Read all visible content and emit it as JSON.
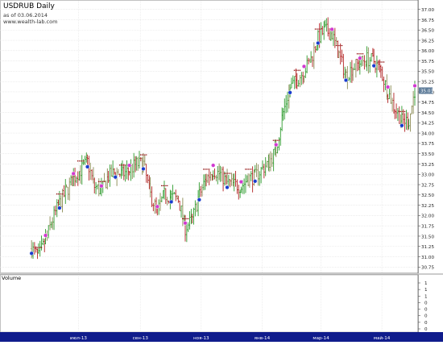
{
  "header": {
    "title": "USDRUB Daily",
    "as_of": "as of 03.06.2014",
    "source": "www.wealth-lab.com"
  },
  "volume_pane": {
    "label": "Volume"
  },
  "colors": {
    "up_bar": "#2e9c2e",
    "down_bar": "#b22222",
    "bar_mixed": "#8a8a52",
    "grid": "#e2e2e2",
    "grid_dotted": "#d0d0d0",
    "axis_band": "#101c8c",
    "last_price_label_bg": "#5f7d9a",
    "marker_blue": "#1a3ccf",
    "marker_red": "#d01818",
    "marker_magenta": "#d13ad1",
    "marker_green": "#1a8a1a",
    "stop_marker": "#8b0000"
  },
  "chart_data": {
    "type": "ohlc",
    "title": "USDRUB Daily",
    "ylim": [
      30.6,
      37.15
    ],
    "y_ticks": [
      "37.00",
      "36.75",
      "36.50",
      "36.25",
      "36.00",
      "35.75",
      "35.50",
      "35.25",
      "35.00",
      "34.75",
      "34.50",
      "34.25",
      "34.00",
      "33.75",
      "33.50",
      "33.25",
      "33.00",
      "32.75",
      "32.50",
      "32.25",
      "32.00",
      "31.75",
      "31.50",
      "31.25",
      "31.00",
      "30.75"
    ],
    "last_price": "35.03",
    "x_ticks": [
      "июл-13",
      "сен-13",
      "ноя-13",
      "янв-14",
      "мар-14",
      "май-14"
    ],
    "volume_ticks": [
      "1",
      "1",
      "1",
      "0",
      "0",
      "0",
      "0",
      "0"
    ],
    "grid": true,
    "series": [
      {
        "type": "close",
        "x": [
          "2013-05-15",
          "2013-05-22",
          "2013-05-29",
          "2013-06-05",
          "2013-06-12",
          "2013-06-19",
          "2013-06-26",
          "2013-07-03",
          "2013-07-10",
          "2013-07-17",
          "2013-07-24",
          "2013-07-31",
          "2013-08-07",
          "2013-08-14",
          "2013-08-21",
          "2013-08-28",
          "2013-09-04",
          "2013-09-11",
          "2013-09-18",
          "2013-09-25",
          "2013-10-02",
          "2013-10-09",
          "2013-10-16",
          "2013-10-23",
          "2013-10-30",
          "2013-11-06",
          "2013-11-13",
          "2013-11-20",
          "2013-11-27",
          "2013-12-04",
          "2013-12-11",
          "2013-12-18",
          "2013-12-25",
          "2014-01-08",
          "2014-01-15",
          "2014-01-22",
          "2014-01-29",
          "2014-02-05",
          "2014-02-12",
          "2014-02-19",
          "2014-02-26",
          "2014-03-05",
          "2014-03-12",
          "2014-03-19",
          "2014-03-26",
          "2014-04-02",
          "2014-04-09",
          "2014-04-16",
          "2014-04-23",
          "2014-04-30",
          "2014-05-07",
          "2014-05-14",
          "2014-05-21",
          "2014-05-28",
          "2014-06-03"
        ],
        "values": [
          31.2,
          31.0,
          31.4,
          31.9,
          32.3,
          32.6,
          32.9,
          33.1,
          33.3,
          32.7,
          32.6,
          32.95,
          33.05,
          33.0,
          33.1,
          33.25,
          33.25,
          32.5,
          32.1,
          32.5,
          32.45,
          32.4,
          31.7,
          31.9,
          32.5,
          32.9,
          33.1,
          33.0,
          32.8,
          32.75,
          32.7,
          32.9,
          32.95,
          33.3,
          33.6,
          34.5,
          35.1,
          35.3,
          35.5,
          35.8,
          36.3,
          36.5,
          36.4,
          35.9,
          35.4,
          35.6,
          35.7,
          35.8,
          35.75,
          35.5,
          35.0,
          34.6,
          34.3,
          34.3,
          35.03
        ]
      }
    ]
  }
}
